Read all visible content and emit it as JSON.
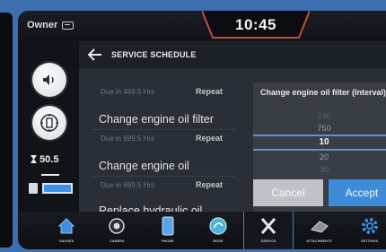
{
  "status_bar": {
    "owner_label": "Owner",
    "time": "10:45"
  },
  "left_panel": {
    "engine_hours": "50.5",
    "fuel_level_percent": 100
  },
  "header": {
    "title": "SERVICE SCHEDULE"
  },
  "service_list": [
    {
      "due": "Due in 449.5 Hrs",
      "repeat": "Repeat",
      "task": "Change engine oil filter"
    },
    {
      "due": "Due in 699.5 Hrs",
      "repeat": "Repeat",
      "task": "Change engine oil"
    },
    {
      "due": "Due in 699.5 Hrs",
      "repeat": "Repeat",
      "task": "Replace hydraulic oil"
    }
  ],
  "interval_dialog": {
    "title": "Change engine oil filter (Interval)",
    "options": [
      "240",
      "750",
      "10",
      "20",
      "30"
    ],
    "selected": "10",
    "cancel_label": "Cancel",
    "accept_label": "Accept"
  },
  "bottom_nav": [
    {
      "label": "GAUGES",
      "icon": "home-icon"
    },
    {
      "label": "CAMERA",
      "icon": "camera-icon"
    },
    {
      "label": "PHONE",
      "icon": "phone-icon"
    },
    {
      "label": "MODE",
      "icon": "mode-icon"
    },
    {
      "label": "SERVICE",
      "icon": "wrench-icon",
      "active": true
    },
    {
      "label": "ATTACHMENTS",
      "icon": "attachment-icon"
    },
    {
      "label": "SETTINGS",
      "icon": "gear-icon"
    }
  ],
  "colors": {
    "accent": "#3d8fe0",
    "background": "#3d6fb0"
  }
}
